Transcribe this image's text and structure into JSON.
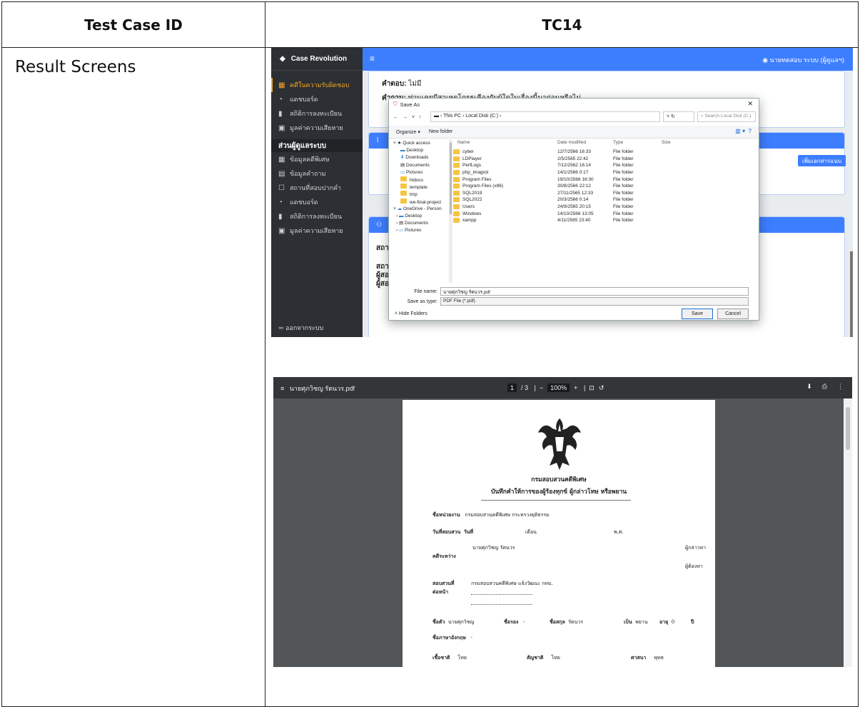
{
  "table": {
    "header_left": "Test Case ID",
    "header_right": "TC14",
    "row_label": "Result Screens"
  },
  "app": {
    "brand": "Case Revolution",
    "user": "นายทดสอบ ระบบ (ผู้ดูแลฯ)",
    "sidebar_items": [
      "คดีในความรับผิดชอบ",
      "แดชบอร์ด",
      "สถิติการลงทะเบียน",
      "มูลค่าความเสียหาย"
    ],
    "admin_header": "ส่วนผู้ดูแลระบบ",
    "admin_items": [
      "ข้อมูลคดีพิเศษ",
      "ข้อมูลคำถาม",
      "สถานที่สอบปากคำ",
      "แดชบอร์ด",
      "สถิติการลงทะเบียน",
      "มูลค่าความเสียหาย"
    ],
    "logout": "ออกจากระบบ",
    "answer_label": "คำตอบ:",
    "answer_value": "ไม่มี",
    "question_label": "คำถาม:",
    "question_value": "ท่านเคยมีสาเหตุโกรธเคืองกับผู้ใดในเรื่องนี้มาก่อนหรือไม่",
    "add_doc_button": "เพิ่มเอกสารแนบ",
    "side_labels": [
      "สถาน",
      "สถาน",
      "ผู้สอบ",
      "ผู้สอบ"
    ]
  },
  "dialog": {
    "title": "Save As",
    "path": "This PC  ›  Local Disk (C:)  ›",
    "search_placeholder": "Search Local Disk (C:)",
    "organize": "Organize ▾",
    "new_folder": "New folder",
    "tree": [
      "Quick access",
      "Desktop",
      "Downloads",
      "Documents",
      "Pictures",
      "htdocs",
      "template",
      "tmp",
      "we-final-project",
      "OneDrive - Person",
      "Desktop",
      "Documents",
      "Pictures"
    ],
    "col_name": "Name",
    "col_date": "Date modified",
    "col_type": "Type",
    "col_size": "Size",
    "files": [
      {
        "name": "cyber",
        "date": "12/7/2566 16:33",
        "type": "File folder"
      },
      {
        "name": "LDPlayer",
        "date": "2/5/2565 22:42",
        "type": "File folder"
      },
      {
        "name": "PerfLogs",
        "date": "7/12/2562 16:14",
        "type": "File folder"
      },
      {
        "name": "php_imagick",
        "date": "14/1/2566 0:17",
        "type": "File folder"
      },
      {
        "name": "Program Files",
        "date": "19/10/2566 16:30",
        "type": "File folder"
      },
      {
        "name": "Program Files (x86)",
        "date": "30/8/2566 22:12",
        "type": "File folder"
      },
      {
        "name": "SQL2019",
        "date": "27/11/2565 12:33",
        "type": "File folder"
      },
      {
        "name": "SQL2022",
        "date": "20/3/2566 0:14",
        "type": "File folder"
      },
      {
        "name": "Users",
        "date": "24/9/2565 20:15",
        "type": "File folder"
      },
      {
        "name": "Windows",
        "date": "14/10/2566 13:05",
        "type": "File folder"
      },
      {
        "name": "xampp",
        "date": "4/11/2565 23:40",
        "type": "File folder"
      }
    ],
    "file_name_label": "File name:",
    "file_name": "นายศุภวิชญ รัตนวร.pdf",
    "save_type_label": "Save as type:",
    "save_type": "PDF File (*.pdf)",
    "hide_folders": "Hide Folders",
    "save": "Save",
    "cancel": "Cancel"
  },
  "pdf": {
    "filename": "นายศุภวิชญ รัตนวร.pdf",
    "page_current": "1",
    "page_total": "/ 3",
    "zoom": "100%",
    "org": "กรมสอบสวนคดีพิเศษ",
    "doc_title": "บันทึกคำให้การของผู้ร้องทุกข์ ผู้กล่าวโทษ หรือพยาน",
    "agency_label": "ชื่อหน่วยงาน",
    "agency_value": "กรมสอบสวนคดีพิเศษ กระทรวงยุติธรรม",
    "date_label": "วันที่สอบสวน",
    "day_label": "วันที่",
    "month_label": "เดือน",
    "year_label": "พ.ศ.",
    "party1": "นายศุภวิชญ รัตนวร",
    "between_label": "คดีระหว่าง",
    "accuser": "ผู้กล่าวหา",
    "accused": "ผู้ต้องหา",
    "place_label": "สอบสวนที่",
    "place_value": "กรมสอบสวนคดีพิเศษ แจ้งวัฒนะ กทม.",
    "before_label": "ต่อหน้า",
    "fname_label": "ชื่อตัว",
    "fname_value": "นายศุภวิชญ",
    "mname_label": "ชื่อรอง",
    "mname_value": "-",
    "lname_label": "ชื่อสกุล",
    "lname_value": "รัตนวร",
    "as_label": "เป็น",
    "as_value": "พยาน",
    "age_label": "อายุ",
    "age_value": "0",
    "year_unit": "ปี",
    "en_name_label": "ชื่อภาษาอังกฤษ",
    "en_name_value": "-",
    "race_label": "เชื้อชาติ",
    "race_value": "ไทย",
    "nation_label": "สัญชาติ",
    "nation_value": "ไทย",
    "religion_label": "ศาสนา",
    "religion_value": "พุทธ"
  }
}
